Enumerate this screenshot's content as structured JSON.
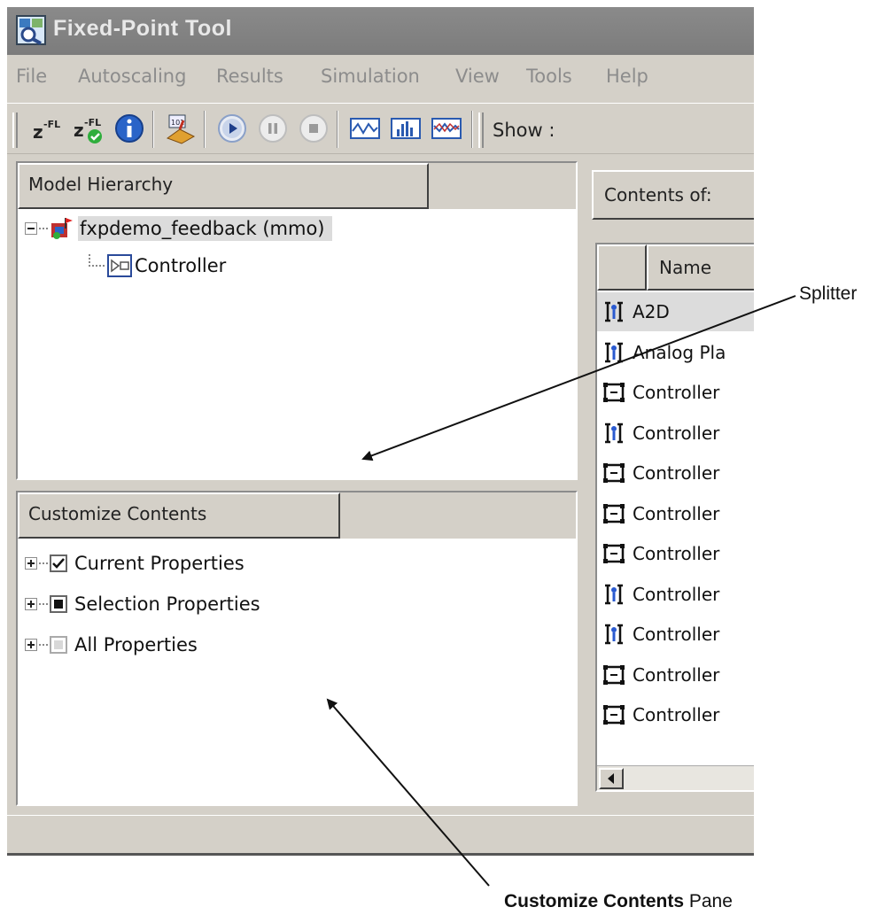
{
  "window": {
    "title": "Fixed-Point Tool"
  },
  "menu": [
    "File",
    "Autoscaling",
    "Results",
    "Simulation",
    "View",
    "Tools",
    "Help"
  ],
  "toolbar": {
    "show_label": "Show :",
    "buttons": [
      "propose-fl-icon",
      "apply-fl-icon",
      "info-icon",
      "data-type-override-icon",
      "play-icon",
      "pause-icon",
      "stop-icon",
      "plot-signal-icon",
      "histogram-icon",
      "compare-plot-icon"
    ]
  },
  "model_hierarchy": {
    "header": "Model Hierarchy",
    "root": "fxpdemo_feedback (mmo)",
    "child": "Controller"
  },
  "customize_contents": {
    "header": "Customize Contents",
    "items": [
      {
        "label": "Current Properties",
        "state": "checked"
      },
      {
        "label": "Selection Properties",
        "state": "partial"
      },
      {
        "label": "All Properties",
        "state": "disabled"
      }
    ]
  },
  "contents": {
    "header": "Contents of:",
    "column_name": "Name",
    "rows": [
      {
        "label": "A2D",
        "icon": "signal-icon",
        "selected": true
      },
      {
        "label": "Analog Pla",
        "icon": "signal-icon"
      },
      {
        "label": "Controller",
        "icon": "block-icon"
      },
      {
        "label": "Controller",
        "icon": "signal-icon"
      },
      {
        "label": "Controller",
        "icon": "block-icon"
      },
      {
        "label": "Controller",
        "icon": "block-icon"
      },
      {
        "label": "Controller",
        "icon": "block-icon"
      },
      {
        "label": "Controller",
        "icon": "signal-icon"
      },
      {
        "label": "Controller",
        "icon": "signal-icon"
      },
      {
        "label": "Controller",
        "icon": "block-icon"
      },
      {
        "label": "Controller",
        "icon": "block-icon"
      }
    ]
  },
  "annotations": {
    "splitter": "Splitter",
    "pane_bold": "Customize Contents",
    "pane_rest": " Pane"
  }
}
